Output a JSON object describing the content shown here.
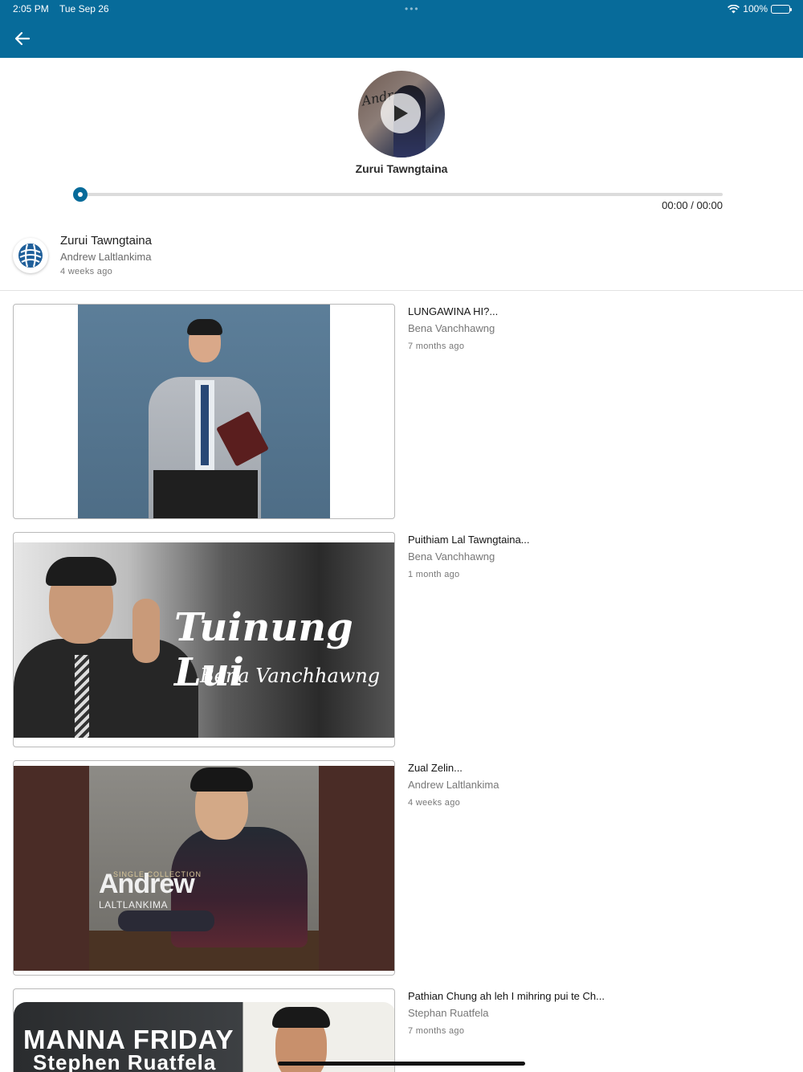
{
  "status_bar": {
    "time": "2:05 PM",
    "date": "Tue Sep 26",
    "battery": "100%"
  },
  "header": {
    "back_icon": "arrow-left-icon"
  },
  "player": {
    "title": "Zurui Tawngtaina",
    "time_readout": "00:00 / 00:00",
    "progress": 0,
    "cover_text": "Andrew"
  },
  "now_playing": {
    "title": "Zurui Tawngtaina",
    "author": "Andrew Laltlankima",
    "ago": "4 weeks ago"
  },
  "videos": [
    {
      "title": "LUNGAWINA HI?...",
      "author": "Bena Vanchhawng",
      "ago": "7 months ago"
    },
    {
      "title": "Puithiam Lal Tawngtaina...",
      "author": "Bena Vanchhawng",
      "ago": "1 month ago",
      "thumb_text": [
        "Tuinung Lui",
        "Bena Vanchhawng"
      ]
    },
    {
      "title": "Zual Zelin...",
      "author": "Andrew Laltlankima",
      "ago": "4 weeks ago",
      "thumb_text": [
        "SINGLE COLLECTION",
        "Andrew",
        "LALTLANKIMA"
      ]
    },
    {
      "title": "Pathian Chung ah leh I mihring pui te Ch...",
      "author": "Stephan Ruatfela",
      "ago": "7 months ago",
      "thumb_text": [
        "MANNA FRIDAY",
        "Stephen Ruatfela"
      ]
    }
  ],
  "colors": {
    "accent": "#076b9a"
  }
}
